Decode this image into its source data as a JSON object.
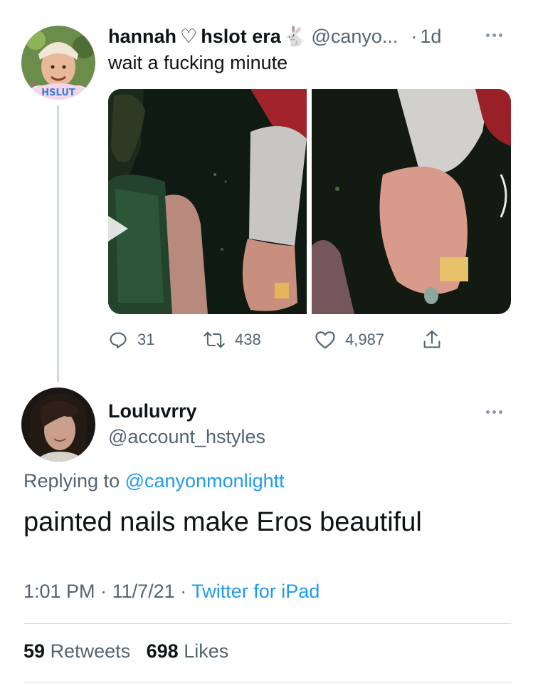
{
  "tweet1": {
    "display_name": "hannah",
    "name_suffix": "hslot era",
    "heart_emoji": "♡",
    "rabbit_emoji": "🐇",
    "handle": "@canyo...",
    "time_sep": "·",
    "time": "1d",
    "avatar_badge": "HSLUT",
    "text": "wait a fucking minute",
    "actions": {
      "reply_count": "31",
      "retweet_count": "438",
      "like_count": "4,987"
    },
    "icons": [
      "reply-icon",
      "retweet-icon",
      "heart-icon",
      "share-icon",
      "more-icon",
      "play-icon"
    ]
  },
  "tweet2": {
    "display_name": "Louluvrry",
    "handle": "@account_hstyles",
    "replying_prefix": "Replying to",
    "replying_to": "@canyonmonlightt",
    "text": "painted nails make Eros beautiful",
    "time": "1:01 PM",
    "sep": "·",
    "date": "11/7/21",
    "source": "Twitter for iPad",
    "retweets": "59",
    "retweets_label": "Retweets",
    "likes": "698",
    "likes_label": "Likes"
  },
  "colors": {
    "primary_text": "#0f1419",
    "secondary_text": "#536471",
    "link": "#1d9bf0",
    "divider": "#cfd9de",
    "avatar_badge_bg": "#f4d6e8",
    "avatar_badge_text": "#3b7fd9"
  }
}
